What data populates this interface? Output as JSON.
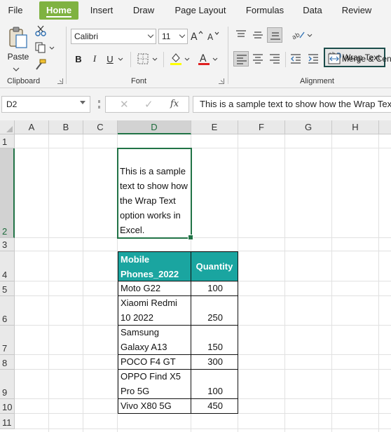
{
  "menu": {
    "tabs": [
      {
        "label": "File",
        "active": false
      },
      {
        "label": "Home",
        "active": true
      },
      {
        "label": "Insert",
        "active": false
      },
      {
        "label": "Draw",
        "active": false
      },
      {
        "label": "Page Layout",
        "active": false
      },
      {
        "label": "Formulas",
        "active": false
      },
      {
        "label": "Data",
        "active": false
      },
      {
        "label": "Review",
        "active": false
      }
    ]
  },
  "ribbon": {
    "clipboard": {
      "paste_label": "Paste",
      "group_label": "Clipboard"
    },
    "font": {
      "font_name": "Calibri",
      "font_size": "11",
      "group_label": "Font",
      "fill_color": "#ffff00",
      "font_color": "#e02020"
    },
    "alignment": {
      "wrap_text_label": "Wrap Text",
      "merge_label": "Merge & Center",
      "group_label": "Alignment"
    }
  },
  "formula_bar": {
    "name_box": "D2",
    "fx_label": "fx",
    "content": "This is a sample text to show how the Wrap Text option works in Excel."
  },
  "sheet": {
    "columns": [
      "A",
      "B",
      "C",
      "D",
      "E",
      "F",
      "G",
      "H"
    ],
    "rows": [
      "1",
      "2",
      "3",
      "4",
      "5",
      "6",
      "7",
      "8",
      "9",
      "10",
      "11"
    ],
    "selected_cell": "D2",
    "d2_text": "This is a sample text to show how the Wrap Text option works in Excel.",
    "table": {
      "headers": [
        "Mobile Phones_2022",
        "Quantity"
      ],
      "header_color": "#1aa5a0",
      "rows": [
        {
          "phone": "Moto G22",
          "quantity": "100"
        },
        {
          "phone": "Xiaomi Redmi 10 2022",
          "quantity": "250"
        },
        {
          "phone": "Samsung Galaxy A13",
          "quantity": "150"
        },
        {
          "phone": "POCO F4 GT",
          "quantity": "300"
        },
        {
          "phone": "OPPO Find X5 Pro 5G",
          "quantity": "100"
        },
        {
          "phone": "Vivo X80 5G",
          "quantity": "450"
        }
      ]
    }
  }
}
